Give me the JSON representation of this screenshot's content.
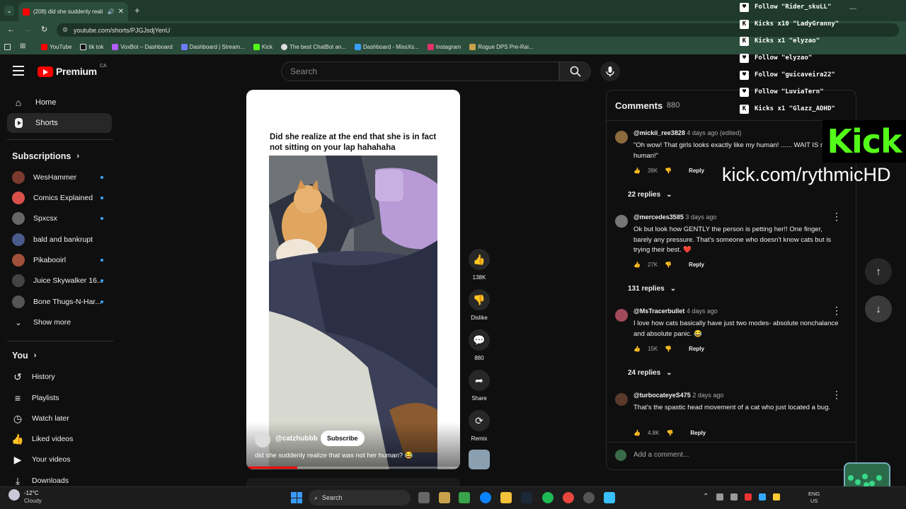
{
  "browser": {
    "tab_title": "(208) did she suddenly reali",
    "url": "youtube.com/shorts/PJGJsdjYenU",
    "bookmarks": [
      "YouTube",
      "tik tok",
      "VoxBot – Dashboard",
      "Dashboard | Stream...",
      "Kick",
      "The best ChatBot an...",
      "Dashboard - MissXs...",
      "Instagram",
      "Rogue DPS Pre-Rai..."
    ]
  },
  "header": {
    "logo": "Premium",
    "region": "CA",
    "search_placeholder": "Search"
  },
  "sidebar": {
    "main": [
      {
        "label": "Home",
        "icon": "home-icon"
      },
      {
        "label": "Shorts",
        "icon": "shorts-icon"
      }
    ],
    "subscriptions_title": "Subscriptions",
    "subscriptions": [
      {
        "name": "WesHammer",
        "color": "#7a3b2e",
        "dot": true
      },
      {
        "name": "Comics Explained",
        "color": "#d9504a",
        "dot": true
      },
      {
        "name": "Spxcsx",
        "color": "#666",
        "dot": true
      },
      {
        "name": "bald and bankrupt",
        "color": "#4a5a8a",
        "dot": false
      },
      {
        "name": "Pikaboоirl",
        "color": "#a0503a",
        "dot": true
      },
      {
        "name": "Juice Skywalker 16...",
        "color": "#444",
        "dot": true
      },
      {
        "name": "Bone Thugs-N-Har...",
        "color": "#555",
        "dot": true
      }
    ],
    "show_more": "Show more",
    "you_title": "You",
    "you_items": [
      {
        "label": "History",
        "icon": "history-icon"
      },
      {
        "label": "Playlists",
        "icon": "playlists-icon"
      },
      {
        "label": "Watch later",
        "icon": "watch-later-icon"
      },
      {
        "label": "Liked videos",
        "icon": "liked-videos-icon"
      },
      {
        "label": "Your videos",
        "icon": "your-videos-icon"
      },
      {
        "label": "Downloads",
        "icon": "downloads-icon"
      }
    ]
  },
  "short": {
    "caption_top": "Did she realize at the end that she is in fact not sitting on your lap hahahaha",
    "channel": "@catzhubbb",
    "subscribe": "Subscribe",
    "title": "did she suddenly realize that was not her human? 😂",
    "likes": "138K",
    "dislike": "Dislike",
    "comments": "880",
    "share": "Share",
    "remix": "Remix"
  },
  "comments_panel": {
    "title": "Comments",
    "count": "880",
    "add_placeholder": "Add a comment...",
    "items": [
      {
        "author": "@mickii_ree3828",
        "time": "4 days ago (edited)",
        "text": "\"Oh wow! That girls looks exactly like my human! ...... WAIT IS my human!\"",
        "likes": "39K",
        "reply": "Reply",
        "replies": "22 replies",
        "color": "#8b6a3e"
      },
      {
        "author": "@mercedes3585",
        "time": "3 days ago",
        "text": "Ok but look how GENTLY the person is petting her!! One finger, barely any pressure. That's someone who doesn't know cats but is trying their best. ❤️",
        "likes": "27K",
        "reply": "Reply",
        "replies": "131 replies",
        "color": "#777"
      },
      {
        "author": "@MsTracerbullet",
        "time": "4 days ago",
        "text": "I love how cats basically have just two modes- absolute nonchalance and absolute panic. 😂",
        "likes": "15K",
        "reply": "Reply",
        "replies": "24 replies",
        "color": "#a04a5a"
      },
      {
        "author": "@turbocateyeS475",
        "time": "2 days ago",
        "text": "That's the spastic head movement of a cat who just located a bug.",
        "likes": "4.8K",
        "reply": "Reply",
        "replies": "",
        "color": "#5a3a2a"
      }
    ]
  },
  "stream_overlay": {
    "alerts": [
      {
        "text": "Follow \"Rider_skuLL\"",
        "icon": "heart-icon"
      },
      {
        "text": "Kicks x10 \"LadyGranny\"",
        "icon": "kick-icon"
      },
      {
        "text": "Kicks x1 \"elyzao\"",
        "icon": "kick-icon"
      },
      {
        "text": "Follow \"elyzao\"",
        "icon": "heart-icon"
      },
      {
        "text": "Follow \"guicaveira22\"",
        "icon": "heart-icon"
      },
      {
        "text": "Follow \"LuviaTern\"",
        "icon": "heart-icon"
      },
      {
        "text": "Kicks x1 \"Glazz_ADHD\"",
        "icon": "kick-icon"
      }
    ],
    "kick_logo": "Kick",
    "kick_url": "kick.com/rythmicHD"
  },
  "taskbar": {
    "weather_temp": "-12°C",
    "weather_desc": "Cloudy",
    "search": "Search",
    "lang": "ENG",
    "region": "US"
  },
  "colors": {
    "accent_red": "#ff0000",
    "kick_green": "#53fc18",
    "link_blue": "#3ea6ff"
  }
}
